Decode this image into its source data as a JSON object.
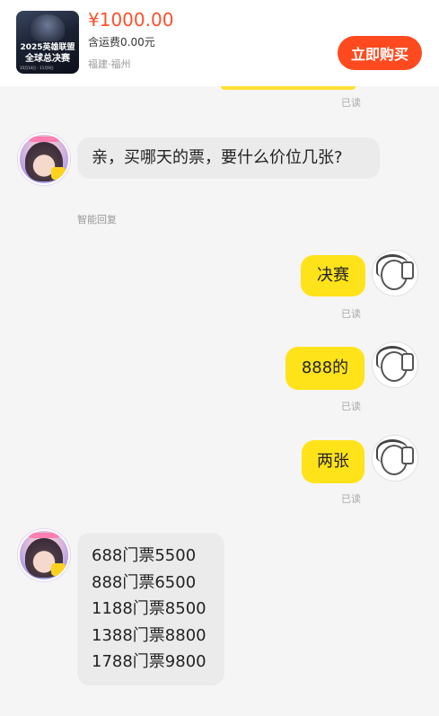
{
  "product": {
    "thumbnail_line1": "2025英雄联盟",
    "thumbnail_line2": "全球总决赛",
    "thumbnail_line3": "10月14日 - 11月9日",
    "price": "¥1000.00",
    "shipping": "含运费0.00元",
    "location": "福建·福州",
    "buy_label": "立即购买"
  },
  "read_label": "已读",
  "smart_reply_label": "智能回复",
  "messages": {
    "seller_question": "亲，买哪天的票，要什么价位几张?",
    "buyer_1": "决赛",
    "buyer_2": "888的",
    "buyer_3": "两张",
    "price_list": [
      "688门票5500",
      "888门票6500",
      "1188门票8500",
      "1388门票8800",
      "1788门票9800"
    ]
  },
  "colors": {
    "price": "#ff4f2b",
    "buy_button": "#ff4a1f",
    "buyer_bubble": "#ffe31a",
    "seller_bubble": "#ebebeb"
  }
}
